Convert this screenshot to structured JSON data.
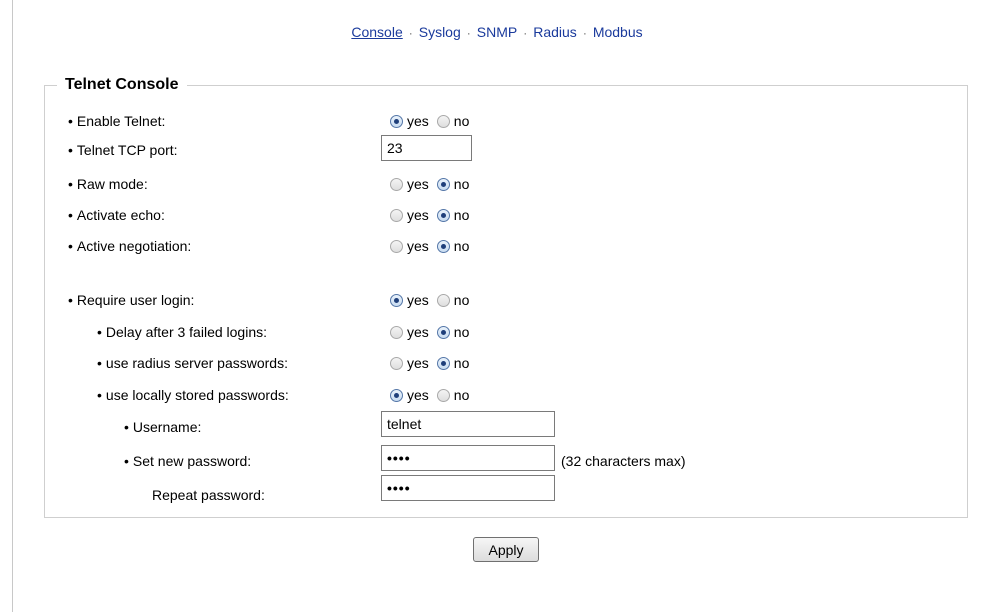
{
  "nav": {
    "items": [
      {
        "label": "Console",
        "active": true
      },
      {
        "label": "Syslog",
        "active": false
      },
      {
        "label": "SNMP",
        "active": false
      },
      {
        "label": "Radius",
        "active": false
      },
      {
        "label": "Modbus",
        "active": false
      }
    ],
    "separator": "·"
  },
  "section": {
    "title": "Telnet Console"
  },
  "bullet": "•",
  "radio_labels": {
    "yes": "yes",
    "no": "no"
  },
  "fields": {
    "enable_telnet": {
      "label": "Enable Telnet:",
      "value": "yes"
    },
    "tcp_port": {
      "label": "Telnet TCP port:",
      "value": "23"
    },
    "raw_mode": {
      "label": "Raw mode:",
      "value": "no"
    },
    "activate_echo": {
      "label": "Activate echo:",
      "value": "no"
    },
    "active_negotiation": {
      "label": "Active negotiation:",
      "value": "no"
    },
    "require_login": {
      "label": "Require user login:",
      "value": "yes"
    },
    "delay_failed": {
      "label": "Delay after 3 failed logins:",
      "value": "no"
    },
    "radius_passwords": {
      "label": "use radius server passwords:",
      "value": "no"
    },
    "local_passwords": {
      "label": "use locally stored passwords:",
      "value": "yes"
    },
    "username": {
      "label": "Username:",
      "value": "telnet"
    },
    "new_password": {
      "label": "Set new password:",
      "value": "••••",
      "hint": "(32 characters max)"
    },
    "repeat_password": {
      "label": "Repeat password:",
      "value": "••••"
    }
  },
  "apply_label": "Apply"
}
